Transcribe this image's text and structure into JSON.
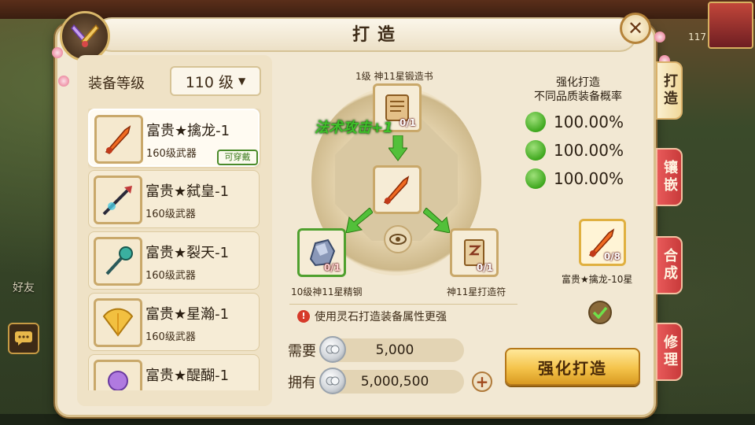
{
  "window": {
    "title": "打造"
  },
  "background": {
    "friends_label": "好友",
    "level_badge": "117"
  },
  "equipment": {
    "level_label": "装备等级",
    "level_value": "110 级"
  },
  "items": [
    {
      "name": "富贵★擒龙-1",
      "sub": "160级武器",
      "badge": "可穿戴",
      "selected": true,
      "icon": "fire-sword-icon"
    },
    {
      "name": "富贵★弑皇-1",
      "sub": "160级武器",
      "badge": "",
      "selected": false,
      "icon": "dark-spear-icon"
    },
    {
      "name": "富贵★裂天-1",
      "sub": "160级武器",
      "badge": "",
      "selected": false,
      "icon": "jade-staff-icon"
    },
    {
      "name": "富贵★星瀚-1",
      "sub": "160级武器",
      "badge": "",
      "selected": false,
      "icon": "golden-fan-icon"
    },
    {
      "name": "富贵★醍醐-1",
      "sub": "",
      "badge": "",
      "selected": false,
      "icon": "purple-orb-icon"
    }
  ],
  "forge": {
    "top_material": {
      "label": "1级  神11星锻造书",
      "count": "0/1",
      "icon": "scroll-book-icon"
    },
    "buff": "法术攻击+1",
    "center_item": {
      "icon": "fire-sword-icon"
    },
    "left_material": {
      "label": "10级神11星精钢",
      "count": "0/1",
      "icon": "steel-ore-icon"
    },
    "right_material": {
      "label": "神11星打造符",
      "count": "0/1",
      "icon": "forge-talisman-icon"
    },
    "hint": "使用灵石打造装备属性更强"
  },
  "cost": {
    "need_label": "需要",
    "need_value": "5,000",
    "have_label": "拥有",
    "have_value": "5,000,500"
  },
  "rates": {
    "title_line1": "强化打造",
    "title_line2": "不同品质装备概率",
    "values": [
      "100.00%",
      "100.00%",
      "100.00%"
    ]
  },
  "result": {
    "name": "富贵★擒龙-10星",
    "count": "0/8"
  },
  "forge_button": "强化打造",
  "tabs": [
    "打造",
    "镶嵌",
    "合成",
    "修理"
  ],
  "colors": {
    "accent": "#f4c34a",
    "tab_red": "#d84848",
    "success_green": "#3fa81e",
    "buff_green": "#3fc02a"
  }
}
